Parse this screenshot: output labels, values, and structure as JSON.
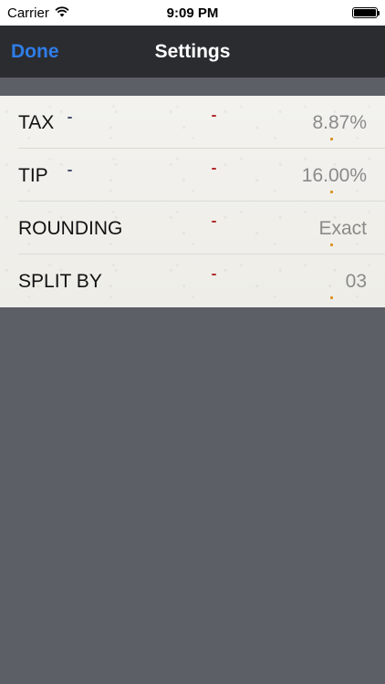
{
  "status_bar": {
    "carrier": "Carrier",
    "time": "9:09 PM"
  },
  "nav": {
    "done_label": "Done",
    "title": "Settings"
  },
  "settings": [
    {
      "label": "TAX",
      "value": "8.87%"
    },
    {
      "label": "TIP",
      "value": "16.00%"
    },
    {
      "label": "ROUNDING",
      "value": "Exact"
    },
    {
      "label": "SPLIT BY",
      "value": "03"
    }
  ],
  "colors": {
    "accent": "#2f7de8",
    "nav_background": "#2b2c30",
    "page_background": "#5c5f66",
    "list_background": "#f1f0ec"
  },
  "icons": {
    "wifi": "wifi-icon",
    "battery": "battery-icon"
  }
}
